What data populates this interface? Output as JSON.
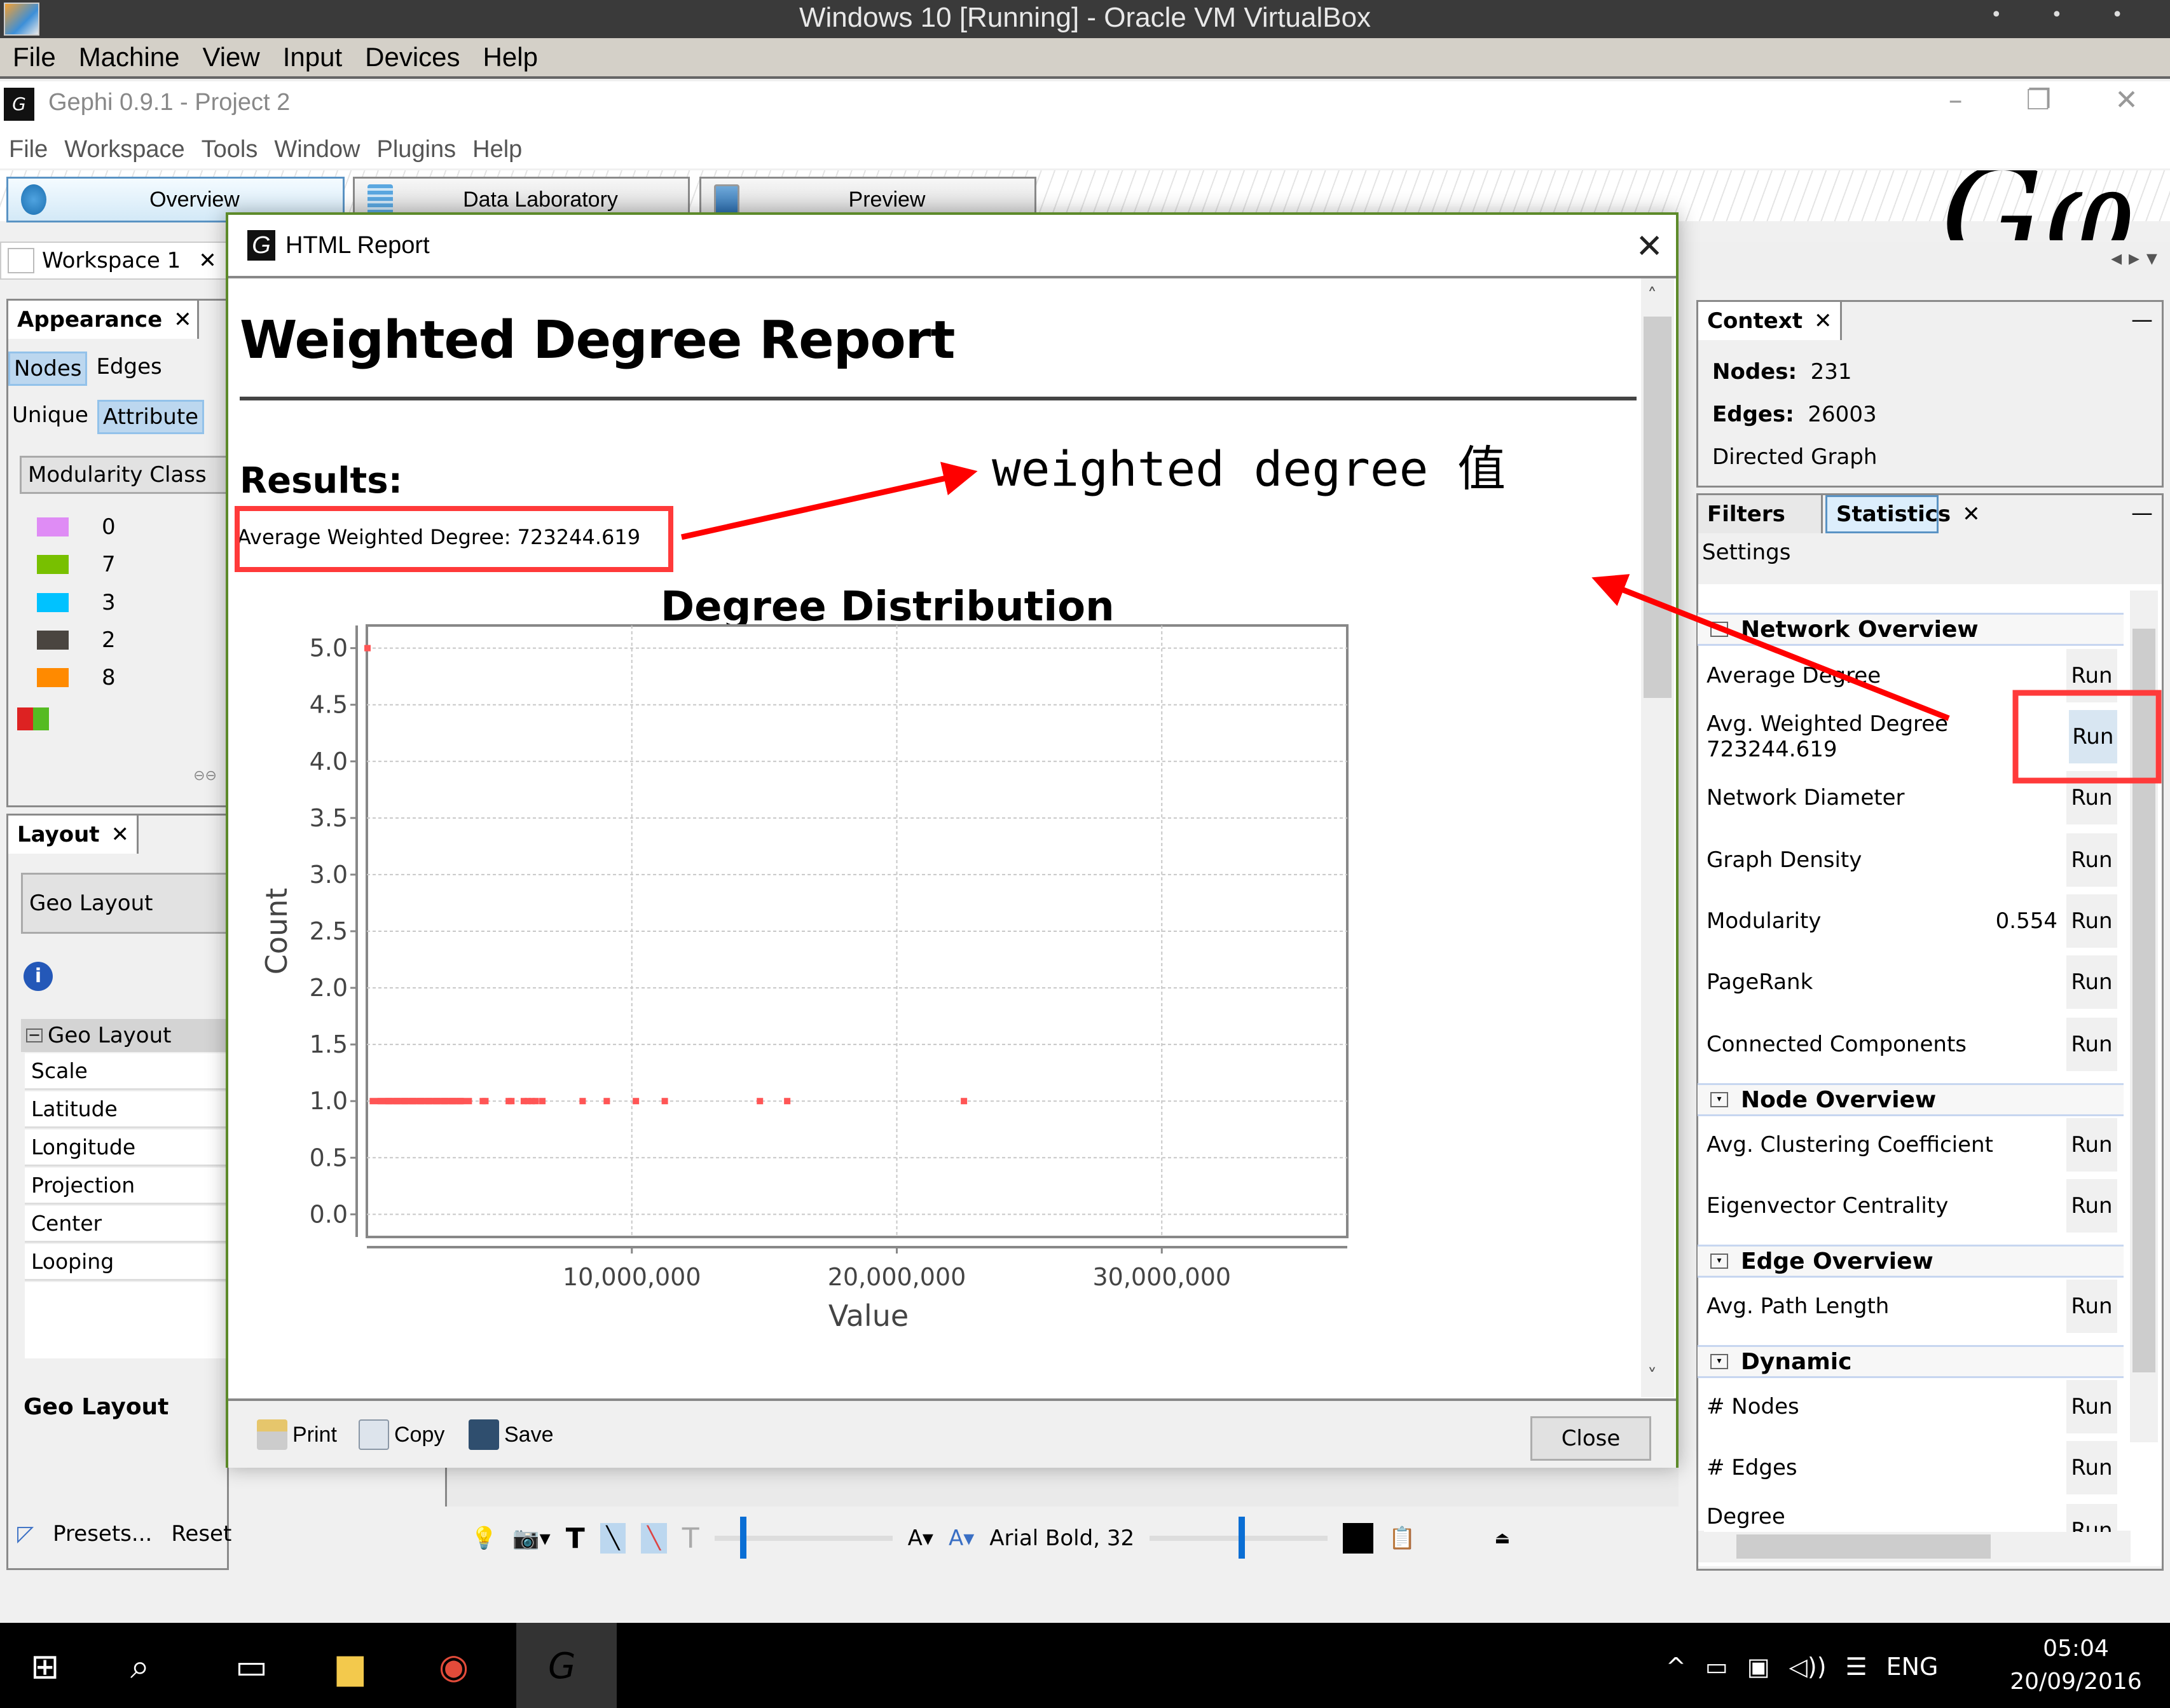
{
  "vbox": {
    "title": "Windows 10 [Running] - Oracle VM VirtualBox",
    "dots": "• • •",
    "menu": [
      "File",
      "Machine",
      "View",
      "Input",
      "Devices",
      "Help"
    ]
  },
  "gephi": {
    "title": "Gephi 0.9.1 - Project 2",
    "window_controls": [
      "–",
      "❐",
      "✕"
    ],
    "menu": [
      "File",
      "Workspace",
      "Tools",
      "Window",
      "Plugins",
      "Help"
    ],
    "workspace_tabs": [
      {
        "label": "Overview",
        "icon": "globe-icon",
        "active": true
      },
      {
        "label": "Data Laboratory",
        "icon": "table-icon",
        "active": false
      },
      {
        "label": "Preview",
        "icon": "monitor-icon",
        "active": false
      }
    ],
    "workspace": {
      "label": "Workspace 1",
      "close": "✕"
    }
  },
  "appearance": {
    "tab": "Appearance",
    "close": "✕",
    "element_toggles": [
      {
        "label": "Nodes",
        "selected": true
      },
      {
        "label": "Edges",
        "selected": false
      }
    ],
    "mode_toggles": [
      {
        "label": "Unique",
        "selected": false
      },
      {
        "label": "Attribute",
        "selected": true
      }
    ],
    "attribute": "Modularity Class",
    "legend": [
      {
        "label": "0",
        "color": "#df8cf5"
      },
      {
        "label": "7",
        "color": "#78c000"
      },
      {
        "label": "3",
        "color": "#00c2ff"
      },
      {
        "label": "2",
        "color": "#4a4540"
      },
      {
        "label": "8",
        "color": "#ff8a00"
      }
    ]
  },
  "layout": {
    "tab": "Layout",
    "close": "✕",
    "selected": "Geo Layout",
    "group": "Geo Layout",
    "properties": [
      "Scale",
      "Latitude",
      "Longitude",
      "Projection",
      "Center",
      "Looping"
    ],
    "description_title": "Geo Layout",
    "presets": "Presets...",
    "reset": "Reset"
  },
  "dialog": {
    "title": "HTML Report",
    "close_x": "✕",
    "heading": "Weighted Degree Report",
    "results_label": "Results:",
    "average_text": "Average Weighted Degree: 723244.619",
    "footer": {
      "print": "Print",
      "copy": "Copy",
      "save": "Save",
      "close": "Close"
    }
  },
  "annotation": {
    "text": "weighted degree 值",
    "color": "#8b0000",
    "highlight_color": "#ff3a3a"
  },
  "chart_data": {
    "type": "scatter",
    "title": "Degree Distribution",
    "xlabel": "Value",
    "ylabel": "Count",
    "xlim": [
      0,
      37000000
    ],
    "ylim": [
      -0.2,
      5.2
    ],
    "xticks": [
      10000000,
      20000000,
      30000000
    ],
    "xtick_labels": [
      "10,000,000",
      "20,000,000",
      "30,000,000"
    ],
    "yticks": [
      0.0,
      0.5,
      1.0,
      1.5,
      2.0,
      2.5,
      3.0,
      3.5,
      4.0,
      4.5,
      5.0
    ],
    "ytick_labels": [
      "0.0",
      "0.5",
      "1.0",
      "1.5",
      "2.0",
      "2.5",
      "3.0",
      "3.5",
      "4.0",
      "4.5",
      "5.0"
    ],
    "grid": true,
    "series": [
      {
        "name": "Degree Distribution",
        "color": "#ff5555",
        "points": [
          {
            "x": 0,
            "y": 5
          },
          {
            "x": 200000,
            "y": 1
          },
          {
            "x": 500000,
            "y": 1
          },
          {
            "x": 800000,
            "y": 1
          },
          {
            "x": 1100000,
            "y": 1
          },
          {
            "x": 1400000,
            "y": 1
          },
          {
            "x": 1700000,
            "y": 1
          },
          {
            "x": 2000000,
            "y": 1
          },
          {
            "x": 2300000,
            "y": 1
          },
          {
            "x": 2600000,
            "y": 1
          },
          {
            "x": 2900000,
            "y": 1
          },
          {
            "x": 3200000,
            "y": 1
          },
          {
            "x": 3480000,
            "y": 1
          },
          {
            "x": 4350000,
            "y": 1
          },
          {
            "x": 4450000,
            "y": 1
          },
          {
            "x": 5330000,
            "y": 1
          },
          {
            "x": 5430000,
            "y": 1
          },
          {
            "x": 5900000,
            "y": 1
          },
          {
            "x": 6050000,
            "y": 1
          },
          {
            "x": 6200000,
            "y": 1
          },
          {
            "x": 6350000,
            "y": 1
          },
          {
            "x": 6600000,
            "y": 1
          },
          {
            "x": 8120000,
            "y": 1
          },
          {
            "x": 9030000,
            "y": 1
          },
          {
            "x": 10130000,
            "y": 1
          },
          {
            "x": 11220000,
            "y": 1
          },
          {
            "x": 14810000,
            "y": 1
          },
          {
            "x": 15840000,
            "y": 1
          },
          {
            "x": 22510000,
            "y": 1
          }
        ]
      }
    ]
  },
  "context": {
    "tab": "Context",
    "close": "✕",
    "minimize": "—",
    "nodes_label": "Nodes:",
    "nodes_value": "231",
    "edges_label": "Edges:",
    "edges_value": "26003",
    "graph_type": "Directed Graph"
  },
  "statistics": {
    "tabs": [
      {
        "label": "Filters",
        "active": false
      },
      {
        "label": "Statistics",
        "active": true
      }
    ],
    "close": "✕",
    "minimize": "—",
    "settings": "Settings",
    "run_label": "Run",
    "sections": [
      {
        "title": "Network Overview",
        "items": [
          {
            "label": "Average Degree",
            "value": ""
          },
          {
            "label": "Avg. Weighted Degree",
            "value": "723244.619"
          },
          {
            "label": "Network Diameter",
            "value": ""
          },
          {
            "label": "Graph Density",
            "value": ""
          },
          {
            "label": "Modularity",
            "value": "0.554"
          },
          {
            "label": "PageRank",
            "value": ""
          },
          {
            "label": "Connected Components",
            "value": ""
          }
        ]
      },
      {
        "title": "Node Overview",
        "items": [
          {
            "label": "Avg. Clustering Coefficient",
            "value": ""
          },
          {
            "label": "Eigenvector Centrality",
            "value": ""
          }
        ]
      },
      {
        "title": "Edge Overview",
        "items": [
          {
            "label": "Avg. Path Length",
            "value": ""
          }
        ]
      },
      {
        "title": "Dynamic",
        "items": [
          {
            "label": "# Nodes",
            "value": ""
          },
          {
            "label": "# Edges",
            "value": ""
          },
          {
            "label": "Degree",
            "value": ""
          }
        ]
      }
    ]
  },
  "bottom_toolbar": {
    "font_label": "Arial Bold, 32"
  },
  "taskbar": {
    "time": "05:04",
    "date": "20/09/2016",
    "language": "ENG"
  }
}
